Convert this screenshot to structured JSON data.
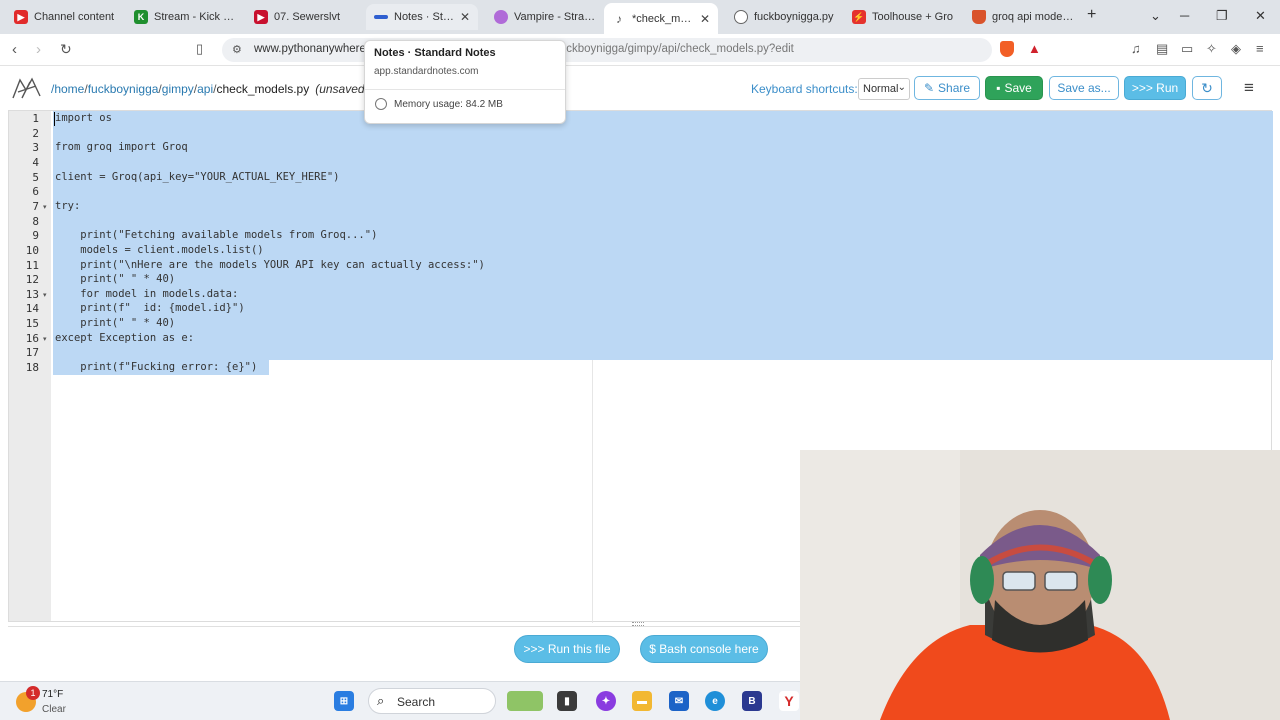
{
  "browser": {
    "tabs": [
      {
        "label": "Channel content",
        "color": "#e12b2b",
        "active": false
      },
      {
        "label": "Stream - Kick Das",
        "color": "#1f8f2e",
        "active": false
      },
      {
        "label": "07. Sewerslvt",
        "color": "#c8102e",
        "active": false
      },
      {
        "label": "Notes · Stand",
        "color": "#2f5fd0",
        "active": false
      },
      {
        "label": "Vampire - Strayye",
        "color": "#b06bd8",
        "active": false
      },
      {
        "label": "*check_mode",
        "color": "#555555",
        "active": true
      },
      {
        "label": "fuckboynigga.py",
        "color": "#666666",
        "active": false
      },
      {
        "label": "Toolhouse + Gro",
        "color": "#e5322d",
        "active": false
      },
      {
        "label": "groq api model ic",
        "color": "#d9532b",
        "active": false
      }
    ],
    "new_tab_label": "+",
    "url_host": "www.pythonanywhere",
    "url_path": "/files/home/fuckboynigga/gimpy/api/check_models.py?edit"
  },
  "hovercard": {
    "title": "Notes · Standard Notes",
    "domain": "app.standardnotes.com",
    "memory": "Memory usage: 84.2 MB"
  },
  "header": {
    "crumbs": [
      "/home",
      "fuckboynigga",
      "gimpy",
      "api"
    ],
    "file": "check_models.py",
    "unsaved": "(unsaved changes)",
    "shortcuts_label": "Keyboard shortcuts:",
    "shortcuts_value": "Normal",
    "share": "Share",
    "save": "Save",
    "save_as": "Save as...",
    "run": ">>> Run"
  },
  "editor": {
    "line_numbers": [
      "1",
      "2",
      "3",
      "4",
      "5",
      "6",
      "7",
      "8",
      "9",
      "10",
      "11",
      "12",
      "13",
      "14",
      "15",
      "16",
      "17",
      "18"
    ],
    "lines": [
      "import os",
      "",
      "from groq import Groq",
      "",
      "client = Groq(api_key=\"YOUR_ACTUAL_KEY_HERE\")",
      "",
      "try:",
      "",
      "    print(\"Fetching available models from Groq...\")",
      "    models = client.models.list()",
      "    print(\"\\nHere are the models YOUR API key can actually access:\")",
      "    print(\" \" * 40)",
      "    for model in models.data:",
      "    print(f\"  id: {model.id}\")",
      "    print(\" \" * 40)",
      "except Exception as e:",
      "",
      "    print(f\"Fucking error: {e}\")"
    ]
  },
  "bottom": {
    "run_file": ">>> Run this file",
    "bash": "$ Bash console here"
  },
  "taskbar": {
    "temp": "71°F",
    "condition": "Clear",
    "search": "Search",
    "badge": "1"
  }
}
